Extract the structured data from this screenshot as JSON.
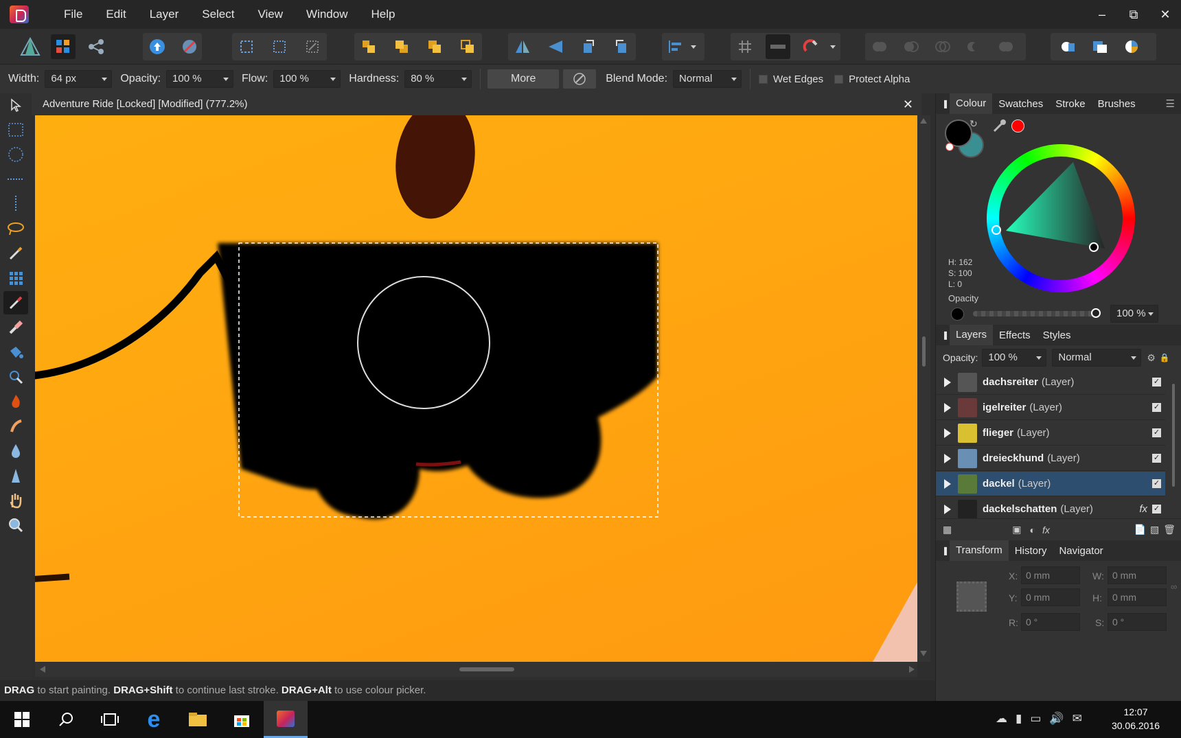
{
  "menubar": {
    "items": [
      "File",
      "Edit",
      "Layer",
      "Select",
      "View",
      "Window",
      "Help"
    ],
    "window_controls": [
      "minimize-icon",
      "restore-icon",
      "close-icon"
    ]
  },
  "context_bar": {
    "width_label": "Width:",
    "width_value": "64 px",
    "opacity_label": "Opacity:",
    "opacity_value": "100 %",
    "flow_label": "Flow:",
    "flow_value": "100 %",
    "hardness_label": "Hardness:",
    "hardness_value": "80 %",
    "more_label": "More",
    "blend_label": "Blend Mode:",
    "blend_value": "Normal",
    "wet_edges_label": "Wet Edges",
    "protect_alpha_label": "Protect Alpha"
  },
  "document": {
    "title": "Adventure Ride [Locked] [Modified] (777.2%)"
  },
  "status": {
    "k1": "DRAG",
    "t1": " to start painting. ",
    "k2": "DRAG+Shift",
    "t2": " to continue last stroke. ",
    "k3": "DRAG+Alt",
    "t3": " to use colour picker."
  },
  "colour_panel": {
    "tabs": [
      "Colour",
      "Swatches",
      "Stroke",
      "Brushes"
    ],
    "h": "H: 162",
    "s": "S: 100",
    "l": "L: 0",
    "opacity_label": "Opacity",
    "opacity_value": "100 %",
    "primary_color": "#000000",
    "secondary_color": "#3a8f92",
    "picker_color": "#ff0000"
  },
  "layers_panel": {
    "tabs": [
      "Layers",
      "Effects",
      "Styles"
    ],
    "opacity_label": "Opacity:",
    "opacity_value": "100 %",
    "blend_value": "Normal",
    "layers": [
      {
        "name": "dachsreiter",
        "kind": "(Layer)"
      },
      {
        "name": "igelreiter",
        "kind": "(Layer)"
      },
      {
        "name": "flieger",
        "kind": "(Layer)"
      },
      {
        "name": "dreieckhund",
        "kind": "(Layer)"
      },
      {
        "name": "dackel",
        "kind": "(Layer)"
      },
      {
        "name": "dackelschatten",
        "kind": "(Layer)"
      }
    ],
    "fx_label": "fx"
  },
  "transform_panel": {
    "tabs": [
      "Transform",
      "History",
      "Navigator"
    ],
    "x_label": "X:",
    "x_value": "0 mm",
    "y_label": "Y:",
    "y_value": "0 mm",
    "w_label": "W:",
    "w_value": "0 mm",
    "h_label": "H:",
    "h_value": "0 mm",
    "r_label": "R:",
    "r_value": "0 °",
    "s_label": "S:",
    "s_value": "0 °"
  },
  "taskbar": {
    "time": "12:07",
    "date": "30.06.2016"
  },
  "colors": {
    "canvas_orange": "#ffa610",
    "selection_accent": "#2d4e6e"
  }
}
